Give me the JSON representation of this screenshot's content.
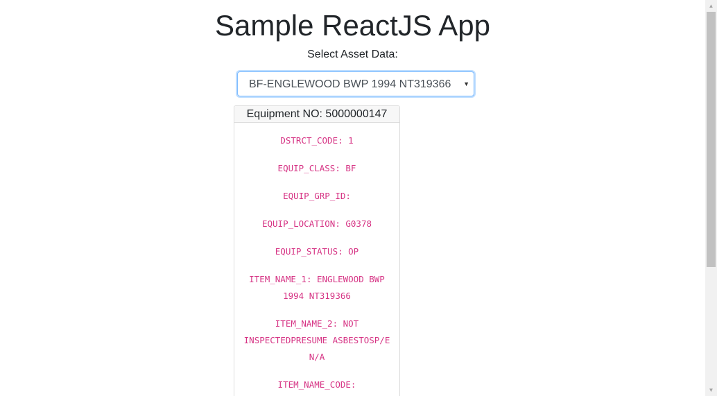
{
  "app": {
    "title": "Sample ReactJS App",
    "select_label": "Select Asset Data:"
  },
  "asset_select": {
    "selected_value": "BF-ENGLEWOOD BWP 1994 NT319366",
    "arrow": "▼"
  },
  "card": {
    "header": "Equipment NO: 5000000147",
    "fields": [
      "DSTRCT_CODE: 1",
      "EQUIP_CLASS: BF",
      "EQUIP_GRP_ID:",
      "EQUIP_LOCATION: G0378",
      "EQUIP_STATUS: OP",
      "ITEM_NAME_1: ENGLEWOOD BWP 1994 NT319366",
      "ITEM_NAME_2: NOT INSPECTEDPRESUME ASBESTOSP/E N/A",
      "ITEM_NAME_CODE:"
    ]
  },
  "scrollbar": {
    "up_arrow": "▲",
    "down_arrow": "▼"
  },
  "colors": {
    "field_text": "#d63384",
    "focus_border": "#80bdff",
    "header_bg": "#f7f7f7"
  }
}
